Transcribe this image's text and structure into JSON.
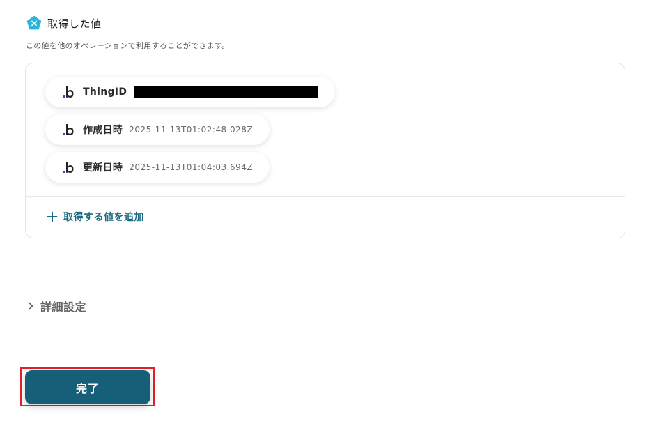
{
  "section": {
    "title": "取得した値",
    "description": "この値を他のオペレーションで利用することができます。",
    "icon": "x-pentagon-icon"
  },
  "values": [
    {
      "label": "ThingID",
      "value": "",
      "redacted": true,
      "icon": "b-app-icon"
    },
    {
      "label": "作成日時",
      "value": "2025-11-13T01:02:48.028Z",
      "redacted": false,
      "icon": "b-app-icon"
    },
    {
      "label": "更新日時",
      "value": "2025-11-13T01:04:03.694Z",
      "redacted": false,
      "icon": "b-app-icon"
    }
  ],
  "add_value": {
    "label": "取得する値を追加",
    "icon": "plus-icon"
  },
  "advanced": {
    "label": "詳細設定",
    "icon": "chevron-right-icon"
  },
  "complete_button": {
    "label": "完了"
  },
  "colors": {
    "accent": "#1b6b83",
    "button": "#155f79",
    "highlight": "#e0222a",
    "icon_cyan": "#29b6d8"
  }
}
